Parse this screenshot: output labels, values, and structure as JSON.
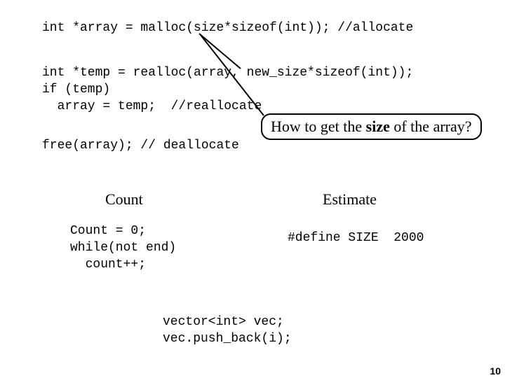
{
  "code": {
    "alloc": "int *array = malloc(size*sizeof(int)); //allocate",
    "realloc1": "int *temp = realloc(array, new_size*sizeof(int));",
    "realloc2": "if (temp)",
    "realloc3": "  array = temp;  //reallocate",
    "free": "free(array); // deallocate"
  },
  "callout": {
    "text_a": "How to get the ",
    "text_b": "size",
    "text_c": " of the array?"
  },
  "headings": {
    "count": "Count",
    "estimate": "Estimate"
  },
  "example": {
    "count1": "Count = 0;",
    "count2": "while(not end)",
    "count3": "  count++;",
    "estimate": "#define SIZE  2000",
    "vector1": "vector<int> vec;",
    "vector2": "vec.push_back(i);"
  },
  "page": "10"
}
